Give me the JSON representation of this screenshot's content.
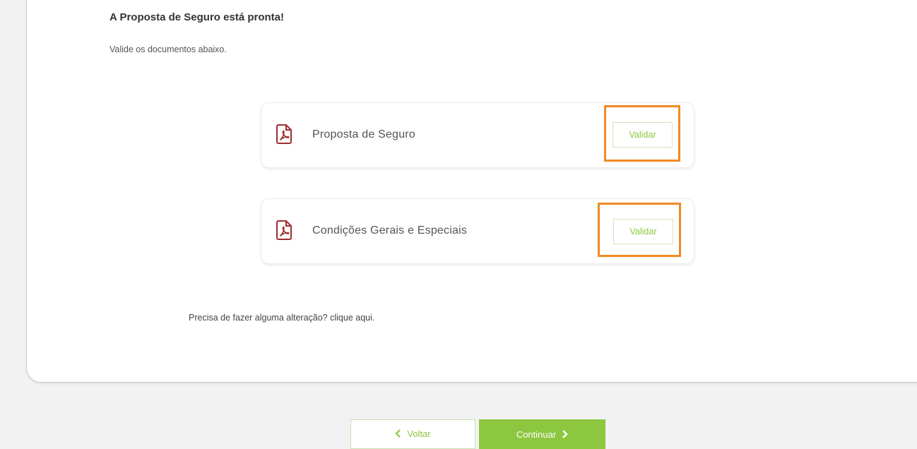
{
  "header": {
    "title": "A Proposta de Seguro está pronta!",
    "subtitle": "Valide os documentos abaixo."
  },
  "documents": [
    {
      "label": "Proposta de Seguro",
      "icon": "pdf-icon",
      "button_label": "Validar"
    },
    {
      "label": "Condições Gerais e Especiais",
      "icon": "pdf-icon",
      "button_label": "Validar"
    }
  ],
  "change_request": {
    "text": "Precisa de fazer alguma alteração? clique aqui."
  },
  "footer": {
    "back_label": "Voltar",
    "continue_label": "Continuar"
  },
  "colors": {
    "accent_green": "#8dc63f",
    "highlight_orange": "#f08a24",
    "pdf_icon_red": "#9e2f2f"
  }
}
